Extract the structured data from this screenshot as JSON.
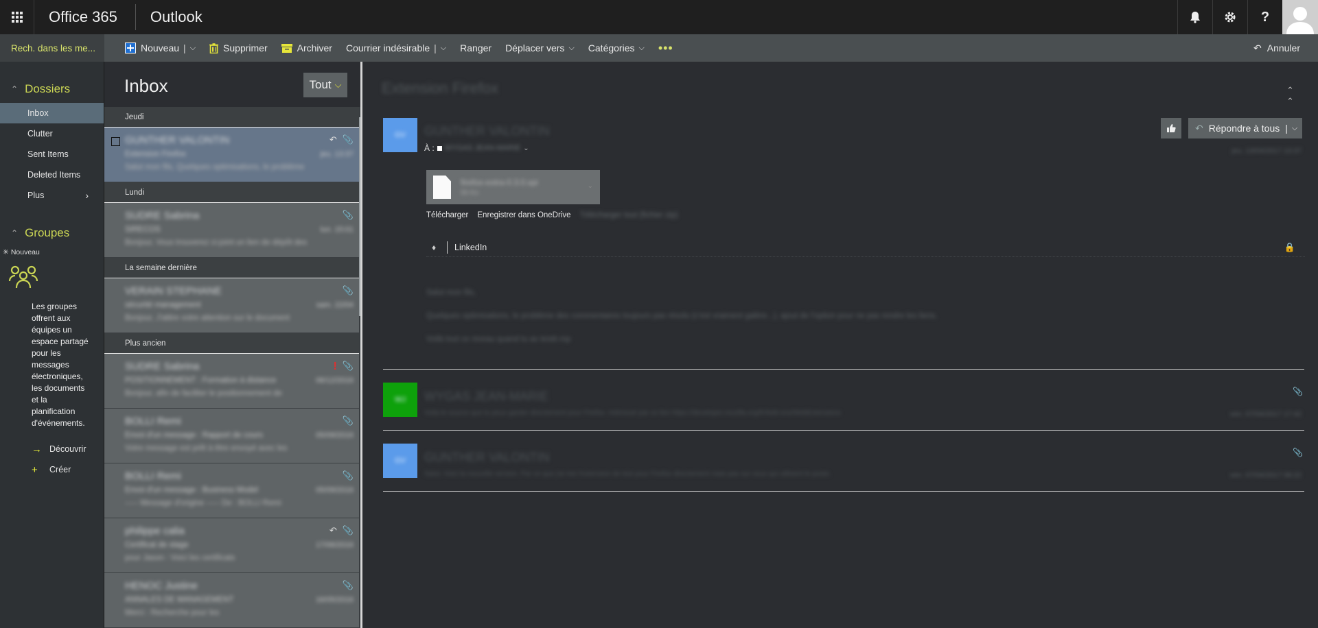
{
  "topbar": {
    "brand": "Office 365",
    "app": "Outlook",
    "icons": [
      "bell-icon",
      "gear-icon",
      "help-icon",
      "user-avatar"
    ]
  },
  "commandbar": {
    "search_placeholder": "Rech. dans les me...",
    "new_label": "Nouveau",
    "delete_label": "Supprimer",
    "archive_label": "Archiver",
    "junk_label": "Courrier indésirable",
    "sweep_label": "Ranger",
    "move_label": "Déplacer vers",
    "categories_label": "Catégories",
    "more_label": "•••",
    "undo_label": "Annuler"
  },
  "leftnav": {
    "folders_header": "Dossiers",
    "folders": [
      {
        "label": "Inbox",
        "active": true
      },
      {
        "label": "Clutter"
      },
      {
        "label": "Sent Items"
      },
      {
        "label": "Deleted Items"
      },
      {
        "label": "Plus"
      }
    ],
    "groups_header": "Groupes",
    "new_group": "Nouveau",
    "groups_text": "Les groupes offrent aux équipes un espace partagé pour les messages électroniques, les documents et la planification d'événements.",
    "discover_label": "Découvrir",
    "create_label": "Créer"
  },
  "messagelist": {
    "title": "Inbox",
    "filter_label": "Tout",
    "groups": [
      {
        "header": "Jeudi",
        "messages": [
          {
            "sender": "GUNTHER VALONTIN",
            "subject": "Extension Firefox",
            "preview": "Salut mon fils, Quelques optimisations, le problème",
            "date": "jeu. 13:37",
            "selected": true,
            "icons": [
              "reply-icon",
              "paperclip-icon"
            ]
          }
        ]
      },
      {
        "header": "Lundi",
        "messages": [
          {
            "sender": "SUDRE Sabrina",
            "subject": "SIRECOS",
            "preview": "Bonjour, Vous trouverez ci-joint un lien de dépôt des",
            "date": "lun. 15:01",
            "icons": [
              "paperclip-icon"
            ]
          }
        ]
      },
      {
        "header": "La semaine dernière",
        "messages": [
          {
            "sender": "VERAIN STEPHANE",
            "subject": "sécurité management",
            "preview": "Bonjour, J'attire votre attention sur le document",
            "date": "sam. 22/04",
            "icons": [
              "paperclip-icon"
            ]
          }
        ]
      },
      {
        "header": "Plus ancien",
        "messages": [
          {
            "sender": "SUDRE Sabrina",
            "subject": "POSITIONNEMENT : Formation à distance",
            "preview": "Bonjour, afin de faciliter le positionnement de",
            "date": "06/12/2016",
            "icons": [
              "flag-icon",
              "paperclip-icon"
            ]
          },
          {
            "sender": "BOLLI Remi",
            "subject": "Envoi d'un message : Rapport de cours",
            "preview": "Votre message est prêt à être envoyé avec les",
            "date": "05/09/2016",
            "icons": [
              "paperclip-icon"
            ]
          },
          {
            "sender": "BOLLI Remi",
            "subject": "Envoi d'un message : Business Model",
            "preview": "----- Message d'origine ----- De : BOLLI Remi",
            "date": "05/09/2016",
            "icons": [
              "paperclip-icon"
            ]
          },
          {
            "sender": "philippe calia",
            "subject": "Certificat de stage",
            "preview": "pour Jason : Voici les certificats",
            "date": "17/06/2016",
            "icons": [
              "reply-icon",
              "paperclip-icon"
            ]
          },
          {
            "sender": "HENOC Justine",
            "subject": "ANNALES DE MANAGEMENT",
            "preview": "Merci : Recherche pour les",
            "date": "16/05/2016",
            "icons": [
              "paperclip-icon"
            ]
          }
        ]
      }
    ]
  },
  "reading": {
    "conversation_title": "Extension Firefox",
    "reply_all_label": "Répondre à tous",
    "to_label": "À :",
    "first": {
      "initials": "GV",
      "sender": "GUNTHER VALONTIN",
      "to": "WYGAS JEAN-MARIE",
      "date": "jeu. 13/04/2017 13:37",
      "attachment_name": "firefox-extra-0.3.0.xpi",
      "attachment_size": "56 Ko",
      "download_label": "Télécharger",
      "onedrive_label": "Enregistrer dans OneDrive",
      "all_attachments_label": "Télécharger tout (fichier zip)",
      "linkedin_label": "LinkedIn",
      "body": [
        "Salut mon fils,",
        "Quelques optimisations, le problème des commentaires toujours pas résolu (c'est vraiment galère...), ajout de l'option pour ne pas rendre les liens.",
        "Voilà tout ce niveau quand tu as testé.mp"
      ]
    },
    "second": {
      "initials": "WJ",
      "sender": "WYGAS JEAN-MARIE",
      "preview": "Voila le source que tu peux garder directement pour Firefox. Intéressé par ce lien https://developer.mozilla.org/fr/Add-ons/WebExtensions",
      "date": "ven. 07/04/2017 17:42"
    },
    "third": {
      "initials": "GV",
      "sender": "GUNTHER VALONTIN",
      "preview": "Salut, Voici la nouvelle version. Par ce que j'ai mis l'extension de test pour Firefox directement mais pas sur ceux qui utilisent le poste.",
      "date": "ven. 07/04/2017 08:22"
    }
  },
  "colors": {
    "accent": "#cbd654",
    "selected_row": "#66768a",
    "avatar_blue": "#5b9bea",
    "avatar_green": "#0ea10b"
  }
}
